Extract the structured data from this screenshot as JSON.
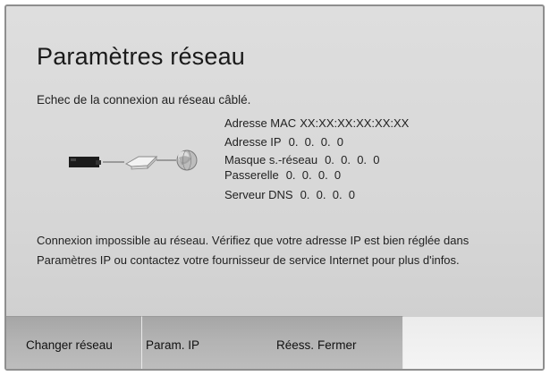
{
  "dialog": {
    "title": "Paramètres réseau",
    "error_message": "Echec de la connexion au réseau câblé."
  },
  "diagram": {
    "icons": [
      "tv-icon",
      "router-icon",
      "globe-icon"
    ],
    "connection_status": "failed"
  },
  "network_info": {
    "mac_label": "Adresse MAC",
    "mac_value": "XX:XX:XX:XX:XX:XX",
    "ip_label": "Adresse IP",
    "ip_value": "0.  0.  0.  0",
    "mask_label": "Masque s.-réseau",
    "mask_value": "0.  0.  0.  0",
    "gateway_label": "Passerelle",
    "gateway_value": "0.  0.  0.  0",
    "dns_label": "Serveur DNS",
    "dns_value": "0.  0.  0.  0"
  },
  "description": {
    "line1": "Connexion impossible au réseau. Vérifiez que votre adresse IP est bien réglée dans",
    "line2": "Paramètres IP ou contactez votre fournisseur de service Internet pour plus d'infos."
  },
  "buttons": {
    "change_network": "Changer réseau",
    "ip_settings": "Param. IP",
    "retry": "Réess.",
    "close": "Fermer"
  }
}
